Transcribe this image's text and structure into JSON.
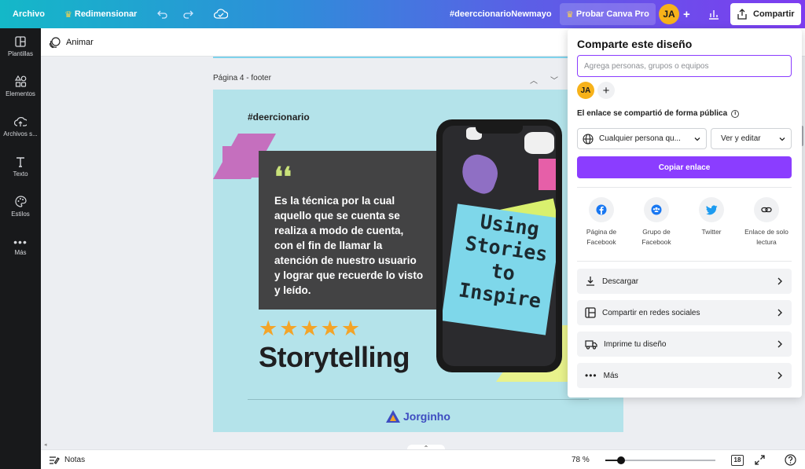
{
  "topbar": {
    "file_label": "Archivo",
    "resize_label": "Redimensionar",
    "design_title": "#deerccionarioNewmayo",
    "pro_label": "Probar Canva Pro",
    "avatar_initials": "JA",
    "share_label": "Compartir"
  },
  "sidebar": {
    "items": [
      {
        "label": "Plantillas",
        "icon": "templates-icon"
      },
      {
        "label": "Elementos",
        "icon": "elements-icon"
      },
      {
        "label": "Archivos s...",
        "icon": "upload-icon"
      },
      {
        "label": "Texto",
        "icon": "text-icon"
      },
      {
        "label": "Estilos",
        "icon": "palette-icon"
      },
      {
        "label": "Más",
        "icon": "more-icon"
      }
    ]
  },
  "subbar": {
    "animate_label": "Animar"
  },
  "canvas": {
    "page_label": "Página 4 - footer",
    "design": {
      "hashtag": "#deercionario",
      "quote_marks": "❛❛",
      "quote_text": "Es la técnica por la cual aquello que se cuenta se realiza a modo de cuenta, con el fin de llamar la atención de nuestro usuario y lograr que recuerde lo visto y leído.",
      "rating": 5,
      "headline": "Storytelling",
      "phone_note": "Using Stories to Inspire",
      "brand": "Jorginho"
    }
  },
  "share_panel": {
    "title": "Comparte este diseño",
    "input_placeholder": "Agrega personas, grupos o equipos",
    "avatar_initials": "JA",
    "link_label": "El enlace se compartió de forma pública",
    "access_select": "Cualquier persona qu...",
    "permission_select": "Ver y editar",
    "copy_label": "Copiar enlace",
    "social": [
      {
        "label": "Página de Facebook",
        "icon": "facebook-icon"
      },
      {
        "label": "Grupo de Facebook",
        "icon": "facebook-group-icon"
      },
      {
        "label": "Twitter",
        "icon": "twitter-icon"
      },
      {
        "label": "Enlace de solo lectura",
        "icon": "link-icon"
      }
    ],
    "actions": [
      {
        "label": "Descargar",
        "icon": "download-icon"
      },
      {
        "label": "Compartir en redes sociales",
        "icon": "social-share-icon"
      },
      {
        "label": "Imprime tu diseño",
        "icon": "truck-icon"
      },
      {
        "label": "Más",
        "icon": "more-icon"
      }
    ]
  },
  "bottombar": {
    "notes_label": "Notas",
    "zoom": "78 %",
    "page_count": "18"
  },
  "colors": {
    "accent": "#8b3dff",
    "page_bg": "#b4e3ea",
    "quote_box": "#434344",
    "stars": "#f3a428"
  }
}
